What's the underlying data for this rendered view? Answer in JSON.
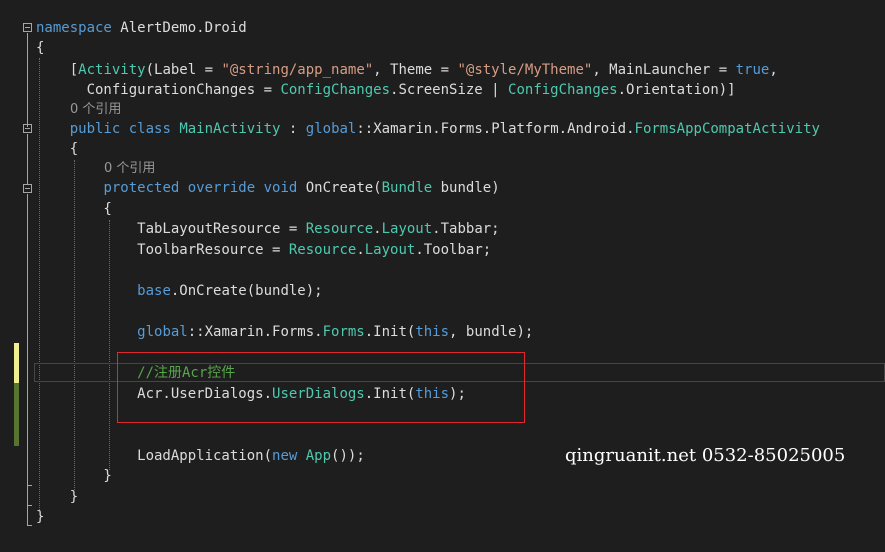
{
  "editor": {
    "codelens": {
      "class_refs": "0 个引用",
      "method_refs": "0 个引用"
    },
    "lines": [
      [
        {
          "t": "namespace",
          "c": "kw"
        },
        {
          "t": " AlertDemo.Droid",
          "c": "pl"
        }
      ],
      [
        {
          "t": "{",
          "c": "pl"
        }
      ],
      [
        {
          "t": "    [",
          "c": "pl"
        },
        {
          "t": "Activity",
          "c": "ty"
        },
        {
          "t": "(Label = ",
          "c": "pl"
        },
        {
          "t": "\"@string/app_name\"",
          "c": "st"
        },
        {
          "t": ", Theme = ",
          "c": "pl"
        },
        {
          "t": "\"@style/MyTheme\"",
          "c": "st"
        },
        {
          "t": ", MainLauncher = ",
          "c": "pl"
        },
        {
          "t": "true",
          "c": "kw"
        },
        {
          "t": ",",
          "c": "pl"
        }
      ],
      [
        {
          "t": "      ConfigurationChanges = ",
          "c": "pl"
        },
        {
          "t": "ConfigChanges",
          "c": "ty"
        },
        {
          "t": ".ScreenSize | ",
          "c": "pl"
        },
        {
          "t": "ConfigChanges",
          "c": "ty"
        },
        {
          "t": ".Orientation)]",
          "c": "pl"
        }
      ],
      [
        {
          "t": "    ",
          "c": "pl"
        },
        {
          "t": "public",
          "c": "kw"
        },
        {
          "t": " ",
          "c": "pl"
        },
        {
          "t": "class",
          "c": "kw"
        },
        {
          "t": " ",
          "c": "pl"
        },
        {
          "t": "MainActivity",
          "c": "ty"
        },
        {
          "t": " : ",
          "c": "pl"
        },
        {
          "t": "global",
          "c": "kw"
        },
        {
          "t": "::Xamarin.Forms.Platform.Android.",
          "c": "pl"
        },
        {
          "t": "FormsAppCompatActivity",
          "c": "ty"
        }
      ],
      [
        {
          "t": "    {",
          "c": "pl"
        }
      ],
      [
        {
          "t": "        ",
          "c": "pl"
        },
        {
          "t": "protected",
          "c": "kw"
        },
        {
          "t": " ",
          "c": "pl"
        },
        {
          "t": "override",
          "c": "kw"
        },
        {
          "t": " ",
          "c": "pl"
        },
        {
          "t": "void",
          "c": "kw"
        },
        {
          "t": " OnCreate(",
          "c": "pl"
        },
        {
          "t": "Bundle",
          "c": "ty"
        },
        {
          "t": " bundle)",
          "c": "pl"
        }
      ],
      [
        {
          "t": "        {",
          "c": "pl"
        }
      ],
      [
        {
          "t": "            TabLayoutResource = ",
          "c": "pl"
        },
        {
          "t": "Resource",
          "c": "ty"
        },
        {
          "t": ".",
          "c": "pl"
        },
        {
          "t": "Layout",
          "c": "ty"
        },
        {
          "t": ".Tabbar;",
          "c": "pl"
        }
      ],
      [
        {
          "t": "            ToolbarResource = ",
          "c": "pl"
        },
        {
          "t": "Resource",
          "c": "ty"
        },
        {
          "t": ".",
          "c": "pl"
        },
        {
          "t": "Layout",
          "c": "ty"
        },
        {
          "t": ".Toolbar;",
          "c": "pl"
        }
      ],
      [],
      [
        {
          "t": "            ",
          "c": "pl"
        },
        {
          "t": "base",
          "c": "kw"
        },
        {
          "t": ".OnCreate(bundle);",
          "c": "pl"
        }
      ],
      [],
      [
        {
          "t": "            ",
          "c": "pl"
        },
        {
          "t": "global",
          "c": "kw"
        },
        {
          "t": "::Xamarin.Forms.",
          "c": "pl"
        },
        {
          "t": "Forms",
          "c": "ty"
        },
        {
          "t": ".Init(",
          "c": "pl"
        },
        {
          "t": "this",
          "c": "kw"
        },
        {
          "t": ", bundle);",
          "c": "pl"
        }
      ],
      [],
      [
        {
          "t": "            //注册Acr控件",
          "c": "cm"
        }
      ],
      [
        {
          "t": "            Acr.UserDialogs.",
          "c": "pl"
        },
        {
          "t": "UserDialogs",
          "c": "ty"
        },
        {
          "t": ".Init(",
          "c": "pl"
        },
        {
          "t": "this",
          "c": "kw"
        },
        {
          "t": ");",
          "c": "pl"
        }
      ],
      [],
      [],
      [
        {
          "t": "            LoadApplication(",
          "c": "pl"
        },
        {
          "t": "new",
          "c": "kw"
        },
        {
          "t": " ",
          "c": "pl"
        },
        {
          "t": "App",
          "c": "ty"
        },
        {
          "t": "());",
          "c": "pl"
        }
      ],
      [
        {
          "t": "        }",
          "c": "pl"
        }
      ],
      [
        {
          "t": "    }",
          "c": "pl"
        }
      ],
      [
        {
          "t": "}",
          "c": "pl"
        }
      ]
    ]
  },
  "watermark": "qingruanit.net 0532-85025005",
  "colors": {
    "background": "#1e1e1e",
    "keyword": "#569cd6",
    "type": "#4ec9b0",
    "string": "#d69d85",
    "comment": "#57a64a",
    "highlight_box": "#e0282e"
  }
}
